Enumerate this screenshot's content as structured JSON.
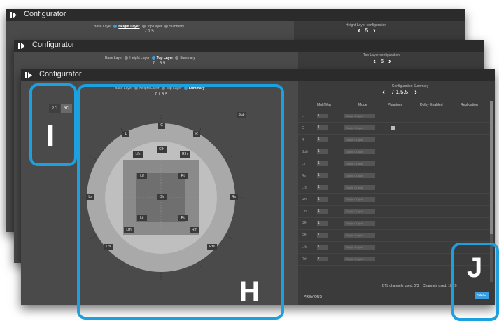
{
  "app_title": "Configurator",
  "windows": [
    {
      "steps": [
        "Base Layer",
        "Height Layer",
        "Top Layer",
        "Summary"
      ],
      "current_step": 1,
      "format": "7.1.5",
      "config_label": "Height Layer configuration",
      "config_value": "5"
    },
    {
      "steps": [
        "Base Layer",
        "Height Layer",
        "Top Layer",
        "Summary"
      ],
      "current_step": 2,
      "format": "7.1.5.5",
      "config_label": "Top Layer configuration",
      "config_value": "5"
    }
  ],
  "main": {
    "steps": [
      "Base Layer",
      "Height Layer",
      "Top Layer",
      "Summary"
    ],
    "current_step": 3,
    "format": "7.1.5.5",
    "view_toggle": [
      "2D",
      "3D"
    ],
    "view_active": "3D",
    "summary_label": "Configuration Summary",
    "summary_value": "7.1.5.5",
    "columns": [
      "MultiWay",
      "Mode",
      "Phantom",
      "Dolby Enabled",
      "Replication"
    ],
    "rows": [
      {
        "name": "L",
        "multiway": "1",
        "mode": "Single Output",
        "phantom": false
      },
      {
        "name": "C",
        "multiway": "1",
        "mode": "Single Output",
        "phantom": true
      },
      {
        "name": "R",
        "multiway": "1",
        "mode": "Single Output",
        "phantom": false
      },
      {
        "name": "Sub",
        "multiway": "1",
        "mode": "Single Output",
        "phantom": false
      },
      {
        "name": "Ls",
        "multiway": "1",
        "mode": "Single Output",
        "phantom": false
      },
      {
        "name": "Rs",
        "multiway": "1",
        "mode": "Single Output",
        "phantom": false
      },
      {
        "name": "Lrs",
        "multiway": "1",
        "mode": "Single Output",
        "phantom": false
      },
      {
        "name": "Rrs",
        "multiway": "1",
        "mode": "Single Output",
        "phantom": false
      },
      {
        "name": "Lfh",
        "multiway": "1",
        "mode": "Single Output",
        "phantom": false
      },
      {
        "name": "Rfh",
        "multiway": "1",
        "mode": "Single Output",
        "phantom": false
      },
      {
        "name": "Cfh",
        "multiway": "1",
        "mode": "Single Output",
        "phantom": false
      },
      {
        "name": "Lrh",
        "multiway": "1",
        "mode": "Single Output",
        "phantom": false
      },
      {
        "name": "Rrh",
        "multiway": "1",
        "mode": "Single Output",
        "phantom": false
      }
    ],
    "btl_used_label": "BTL channels used:",
    "btl_used_value": "0/3",
    "channels_used_label": "Channels used:",
    "channels_used_value": "18/20",
    "previous_label": "PREVIOUS",
    "save_label": "SAVE",
    "speakers": {
      "c": "C",
      "l": "L",
      "r": "R",
      "sub": "Sub",
      "ls": "Ls",
      "rs": "Rs",
      "lrs": "Lrs",
      "rrs": "Rrs",
      "lfh": "Lfh",
      "rfh": "Rfh",
      "cfh": "Cfh",
      "lrh": "Lrh",
      "rrh": "Rrh",
      "ltf": "Ltf",
      "rtf": "Rtf",
      "oh": "Oh",
      "ltr": "Ltr",
      "rtr": "Rtr"
    }
  },
  "callouts": {
    "i": "I",
    "h": "H",
    "j": "J"
  },
  "colors": {
    "accent": "#3d9dde",
    "callout": "#1ca0e0",
    "titlebar": "#2b2b2b"
  }
}
